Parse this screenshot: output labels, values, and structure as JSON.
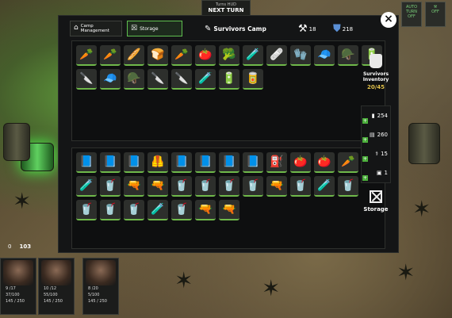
{
  "top_bar": {
    "subtitle": "Turns HUD",
    "title": "NEXT TURN",
    "auto_turn_label": "AUTO TURN",
    "auto_turn_state": "OFF",
    "corner_state": "OFF"
  },
  "tabs": {
    "camp_management": "Camp Management",
    "storage": "Storage",
    "survivors_camp": "Survivors Camp"
  },
  "resources": {
    "tools": "18",
    "defense": "218"
  },
  "top_items": [
    {
      "icon": "🥕"
    },
    {
      "icon": "🥕"
    },
    {
      "icon": "🥖"
    },
    {
      "icon": "🍞"
    },
    {
      "icon": "🥕"
    },
    {
      "icon": "🍅"
    },
    {
      "icon": "🥦"
    },
    {
      "icon": "🧪"
    },
    {
      "icon": "🩹"
    },
    {
      "icon": "🧤"
    },
    {
      "icon": "🧢"
    },
    {
      "icon": "🪖"
    },
    {
      "icon": "🔋"
    },
    {
      "icon": "🔪"
    },
    {
      "icon": "🧢"
    },
    {
      "icon": "🪖"
    },
    {
      "icon": "🔪"
    },
    {
      "icon": "🔪"
    },
    {
      "icon": "🧪"
    },
    {
      "icon": "🔋"
    },
    {
      "icon": "🥫"
    }
  ],
  "bottom_items": [
    {
      "icon": "📘"
    },
    {
      "icon": "📘"
    },
    {
      "icon": "📘"
    },
    {
      "icon": "🦺"
    },
    {
      "icon": "📘"
    },
    {
      "icon": "📘"
    },
    {
      "icon": "📘"
    },
    {
      "icon": "📘"
    },
    {
      "icon": "⛽"
    },
    {
      "icon": "🍅"
    },
    {
      "icon": "🍅"
    },
    {
      "icon": "🥕"
    },
    {
      "icon": "🧪"
    },
    {
      "icon": "🥤"
    },
    {
      "icon": "🔫"
    },
    {
      "icon": "🔫"
    },
    {
      "icon": "🥤"
    },
    {
      "icon": "🥤"
    },
    {
      "icon": "🥤"
    },
    {
      "icon": "🥤"
    },
    {
      "icon": "🔫"
    },
    {
      "icon": "🥤"
    },
    {
      "icon": "🧪"
    },
    {
      "icon": "🥤"
    },
    {
      "icon": "🥤"
    },
    {
      "icon": "🥤"
    },
    {
      "icon": "🥤"
    },
    {
      "icon": "🧪"
    },
    {
      "icon": "🥤"
    },
    {
      "icon": "🔫"
    },
    {
      "icon": "🔫"
    }
  ],
  "side_panel": {
    "title": "Survivors Inventory",
    "capacity": "20/45",
    "counters": [
      {
        "value": "254"
      },
      {
        "value": "260"
      },
      {
        "value": "15"
      },
      {
        "value": "1"
      }
    ],
    "storage_label": "Storage"
  },
  "bottom_stats": {
    "stat_a": "0",
    "stat_b": "103"
  },
  "survivors": [
    {
      "hp": "9 /17",
      "food": "37/100",
      "water": "145 / 250"
    },
    {
      "hp": "10 /12",
      "food": "55/100",
      "water": "145 / 250"
    },
    {
      "hp": "8 /20",
      "food": "5/100",
      "water": "145 / 250"
    }
  ],
  "colors": {
    "accent_green": "#6fb84a",
    "gold": "#e1c14b",
    "panel_bg": "#141516"
  }
}
